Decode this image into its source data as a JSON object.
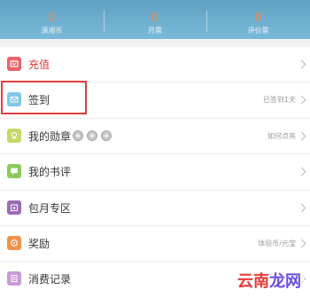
{
  "stats": [
    {
      "value": "0",
      "label": "潇湘币"
    },
    {
      "value": "0",
      "label": "月票"
    },
    {
      "value": "0",
      "label": "评价票"
    }
  ],
  "menu": [
    {
      "key": "recharge",
      "label": "充值",
      "right": "",
      "icon": "wallet-icon",
      "color": "#e8646a",
      "labelColor": "#e03a3a"
    },
    {
      "key": "signin",
      "label": "签到",
      "right": "已签到1天",
      "icon": "envelope-icon",
      "color": "#7fc7e6"
    },
    {
      "key": "medals",
      "label": "我的勋章",
      "right": "如何点亮",
      "icon": "medal-icon",
      "color": "#c7d96a"
    },
    {
      "key": "reviews",
      "label": "我的书评",
      "right": "",
      "icon": "chat-icon",
      "color": "#8cc85a"
    },
    {
      "key": "monthly",
      "label": "包月专区",
      "right": "",
      "icon": "calendar-icon",
      "color": "#9b6ab6"
    },
    {
      "key": "rewards",
      "label": "奖励",
      "right": "体验币/元宝",
      "icon": "gift-icon",
      "color": "#f0914a"
    },
    {
      "key": "records",
      "label": "消费记录",
      "right": "",
      "icon": "receipt-icon",
      "color": "#c99ad6"
    }
  ],
  "watermark": {
    "text_left": "云南",
    "text_right": "龙网"
  }
}
